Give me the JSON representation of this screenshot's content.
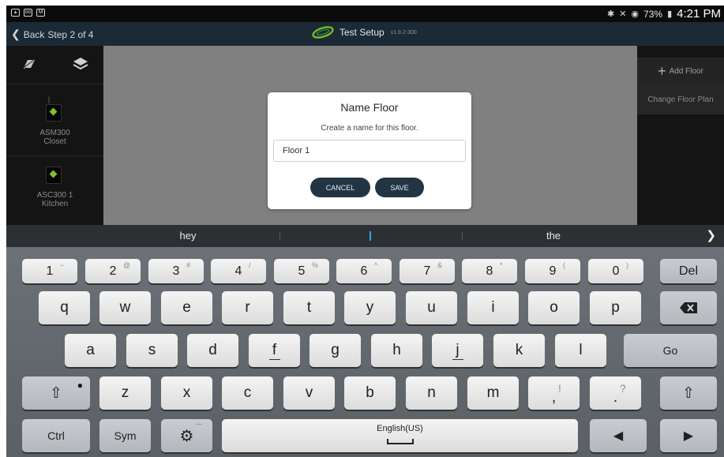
{
  "status": {
    "battery": "73%",
    "time": "4:21 PM"
  },
  "appbar": {
    "back_label": "Back",
    "step_label": "Step 2 of 4",
    "title": "Test Setup",
    "version": "v1.9.2-300"
  },
  "sensors": [
    {
      "name": "ASM300",
      "location": "Closet"
    },
    {
      "name": "ASC300 1",
      "location": "Kitchen"
    }
  ],
  "right_panel": {
    "add_floor": "Add Floor",
    "change_floor": "Change Floor Plan"
  },
  "dialog": {
    "title": "Name Floor",
    "subtitle": "Create a name for this floor.",
    "input_value": "Floor 1",
    "cancel_label": "CANCEL",
    "save_label": "SAVE"
  },
  "suggestions": [
    "hey",
    "I",
    "the"
  ],
  "keyboard": {
    "number_row": [
      {
        "main": "1",
        "alt": "~"
      },
      {
        "main": "2",
        "alt": "@"
      },
      {
        "main": "3",
        "alt": "#"
      },
      {
        "main": "4",
        "alt": "/"
      },
      {
        "main": "5",
        "alt": "%"
      },
      {
        "main": "6",
        "alt": "^"
      },
      {
        "main": "7",
        "alt": "&"
      },
      {
        "main": "8",
        "alt": "*"
      },
      {
        "main": "9",
        "alt": "("
      },
      {
        "main": "0",
        "alt": ")"
      }
    ],
    "del_label": "Del",
    "row1": [
      "q",
      "w",
      "e",
      "r",
      "t",
      "y",
      "u",
      "i",
      "o",
      "p"
    ],
    "row2": [
      "a",
      "s",
      "d",
      "f",
      "g",
      "h",
      "j",
      "k",
      "l"
    ],
    "go_label": "Go",
    "row3": [
      "z",
      "x",
      "c",
      "v",
      "b",
      "n",
      "m"
    ],
    "comma": {
      "main": ",",
      "alt": "!"
    },
    "period": {
      "main": ".",
      "alt": "?"
    },
    "ctrl_label": "Ctrl",
    "sym_label": "Sym",
    "space_label": "English(US)",
    "gear_more": "...",
    "shift_glyph": "⇧",
    "left_arrow": "◀",
    "right_arrow": "▶",
    "backspace_glyph": "⌫"
  },
  "colors": {
    "accent_green": "#7ec12b",
    "dialog_button": "#213545",
    "cursor_blue": "#29a8e0"
  }
}
